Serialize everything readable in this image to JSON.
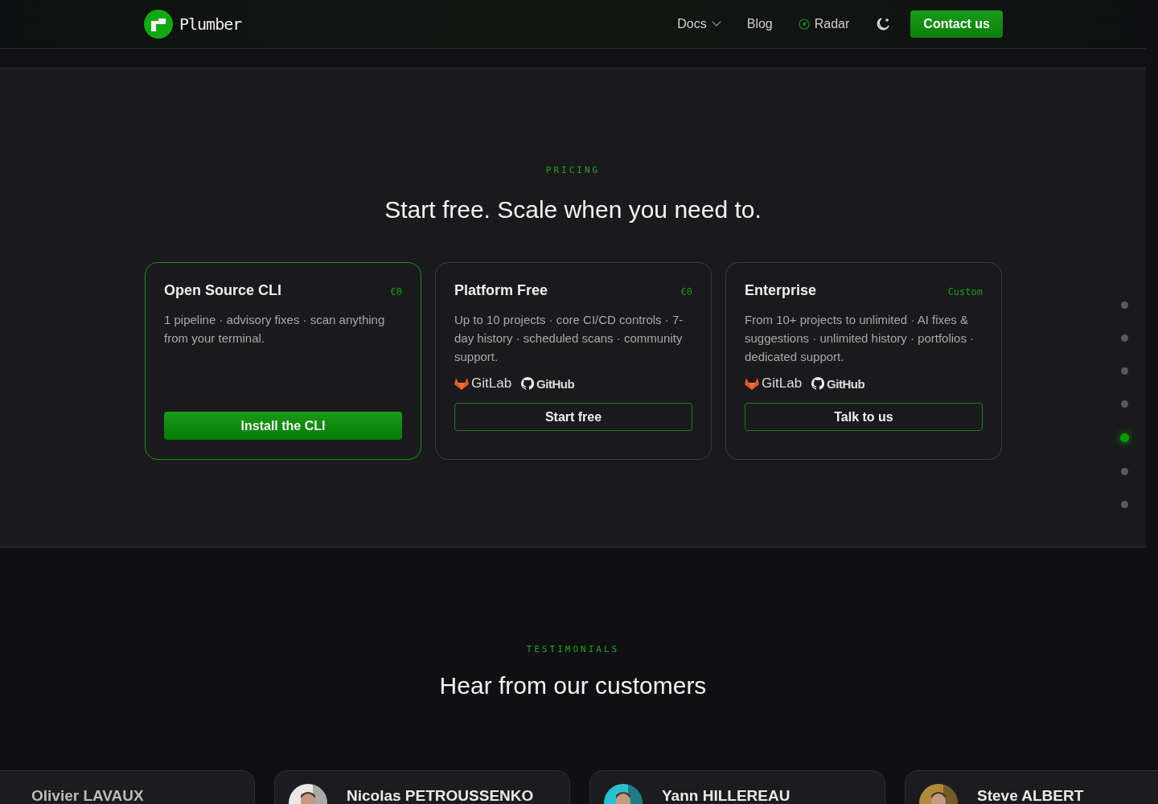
{
  "header": {
    "brand": "Plumber",
    "nav": [
      {
        "label": "Docs",
        "kind": "dropdown"
      },
      {
        "label": "Blog",
        "kind": "link"
      },
      {
        "label": "Radar",
        "kind": "radar"
      }
    ],
    "cta": "Contact us"
  },
  "pricing": {
    "eyebrow": "PRICING",
    "title": "Start free. Scale when you need to.",
    "plans": [
      {
        "name": "Open Source CLI",
        "price": "€0",
        "featured": true,
        "description": "1 pipeline · advisory fixes · scan anything from your terminal.",
        "button": "Install the CLI"
      },
      {
        "name": "Platform Free",
        "price": "€0",
        "featured": false,
        "description": "Up to 10 projects · core CI/CD controls · 7-day history · scheduled scans · community support.",
        "platforms": [
          "GitLab",
          "GitHub"
        ],
        "button": "Start free"
      },
      {
        "name": "Enterprise",
        "price": "Custom",
        "featured": false,
        "description": "From 10+ projects to unlimited · AI fixes & suggestions · unlimited history · portfolios · dedicated support.",
        "platforms": [
          "GitLab",
          "GitHub"
        ],
        "button": "Talk to us"
      }
    ]
  },
  "section_dots": [
    {
      "selected": false
    },
    {
      "selected": false
    },
    {
      "selected": false
    },
    {
      "selected": false
    },
    {
      "selected": true
    },
    {
      "selected": false
    },
    {
      "selected": false
    }
  ],
  "testimonials": {
    "eyebrow": "TESTIMONIALS",
    "title": "Hear from our customers",
    "people": [
      {
        "name": "Olivier LAVAUX",
        "avatar": false
      },
      {
        "name": "Nicolas PETROUSSENKO",
        "avatar": true
      },
      {
        "name": "Yann HILLEREAU",
        "avatar": true
      },
      {
        "name": "Steve ALBERT",
        "avatar": true
      }
    ]
  }
}
